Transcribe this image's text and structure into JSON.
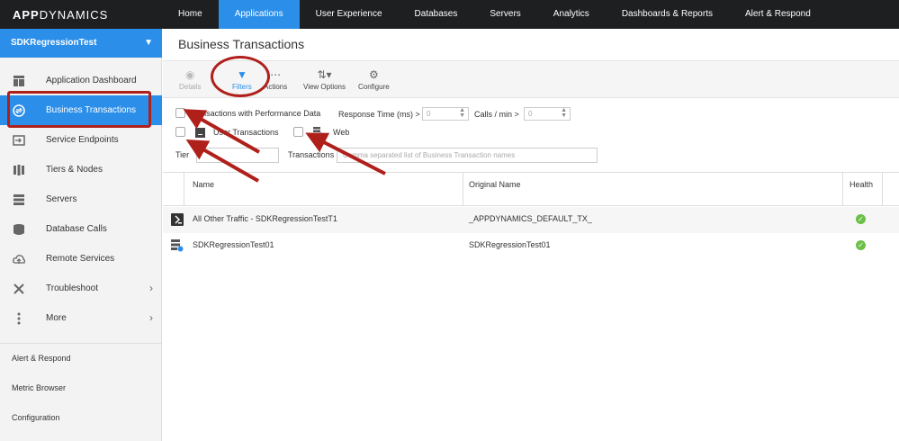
{
  "logo": {
    "strong": "APP",
    "rest": "DYNAMICS"
  },
  "nav": [
    {
      "label": "Home",
      "active": false
    },
    {
      "label": "Applications",
      "active": true
    },
    {
      "label": "User Experience",
      "active": false
    },
    {
      "label": "Databases",
      "active": false
    },
    {
      "label": "Servers",
      "active": false
    },
    {
      "label": "Analytics",
      "active": false
    },
    {
      "label": "Dashboards & Reports",
      "active": false
    },
    {
      "label": "Alert & Respond",
      "active": false
    }
  ],
  "sidebar": {
    "app_name": "SDKRegressionTest",
    "items": [
      {
        "label": "Application Dashboard",
        "icon": "dashboard-icon"
      },
      {
        "label": "Business Transactions",
        "icon": "transactions-icon",
        "active": true
      },
      {
        "label": "Service Endpoints",
        "icon": "endpoint-icon"
      },
      {
        "label": "Tiers & Nodes",
        "icon": "tiers-icon"
      },
      {
        "label": "Servers",
        "icon": "servers-icon"
      },
      {
        "label": "Database Calls",
        "icon": "database-icon"
      },
      {
        "label": "Remote Services",
        "icon": "cloud-icon"
      },
      {
        "label": "Troubleshoot",
        "icon": "tools-icon"
      },
      {
        "label": "More",
        "icon": "more-icon"
      }
    ],
    "links": [
      "Alert & Respond",
      "Metric Browser",
      "Configuration"
    ]
  },
  "page": {
    "title": "Business Transactions"
  },
  "toolbar": {
    "details": "Details",
    "filters": "Filters",
    "actions": "Actions",
    "view_options": "View Options",
    "configure": "Configure"
  },
  "filters": {
    "perf_data": "Transactions with Performance Data",
    "response_time": "Response Time (ms) >",
    "response_value": "0",
    "calls": "Calls / min >",
    "calls_value": "0",
    "user_tx": "User Transactions",
    "web": "Web",
    "tier": "Tier",
    "transactions": "Transactions",
    "transactions_placeholder": "Comma separated list of Business Transaction names"
  },
  "table": {
    "headers": {
      "name": "Name",
      "original": "Original Name",
      "health": "Health"
    },
    "rows": [
      {
        "name": "All Other Traffic - SDKRegressionTestT1",
        "original": "_APPDYNAMICS_DEFAULT_TX_",
        "health": "ok"
      },
      {
        "name": "SDKRegressionTest01",
        "original": "SDKRegressionTest01",
        "health": "ok"
      }
    ]
  },
  "colors": {
    "accent": "#2b8ee8",
    "topbar": "#1d1f21",
    "annotation": "#b0201b",
    "health_ok": "#6cc049"
  }
}
